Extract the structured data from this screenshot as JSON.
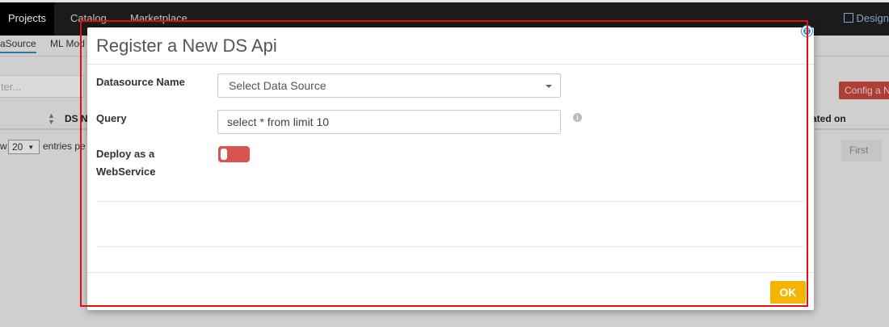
{
  "topbar": {
    "tabs": [
      "Projects",
      "Catalog",
      "Marketplace"
    ],
    "design_label": "Design"
  },
  "subtabs": [
    "aSource",
    "ML Mod"
  ],
  "filter_placeholder": "ter...",
  "config_button": "Config a N",
  "table": {
    "headers": [
      "DS N",
      "ated on"
    ]
  },
  "paging": {
    "show_prefix": "w",
    "page_size": "20",
    "entries_label": "entries pe",
    "first": "First"
  },
  "modal": {
    "title": "Register a New DS Api",
    "datasource_label": "Datasource Name",
    "datasource_placeholder": "Select Data Source",
    "query_label": "Query",
    "query_value": "select * from  limit 10",
    "deploy_label_line1": "Deploy as a",
    "deploy_label_line2": "WebService",
    "deploy_enabled": false,
    "ok_label": "OK"
  },
  "colors": {
    "accent_blue": "#2f8fd0",
    "toggle_off": "#d9534f",
    "ok_button": "#f4b400",
    "highlight_outline": "#dd1111"
  }
}
